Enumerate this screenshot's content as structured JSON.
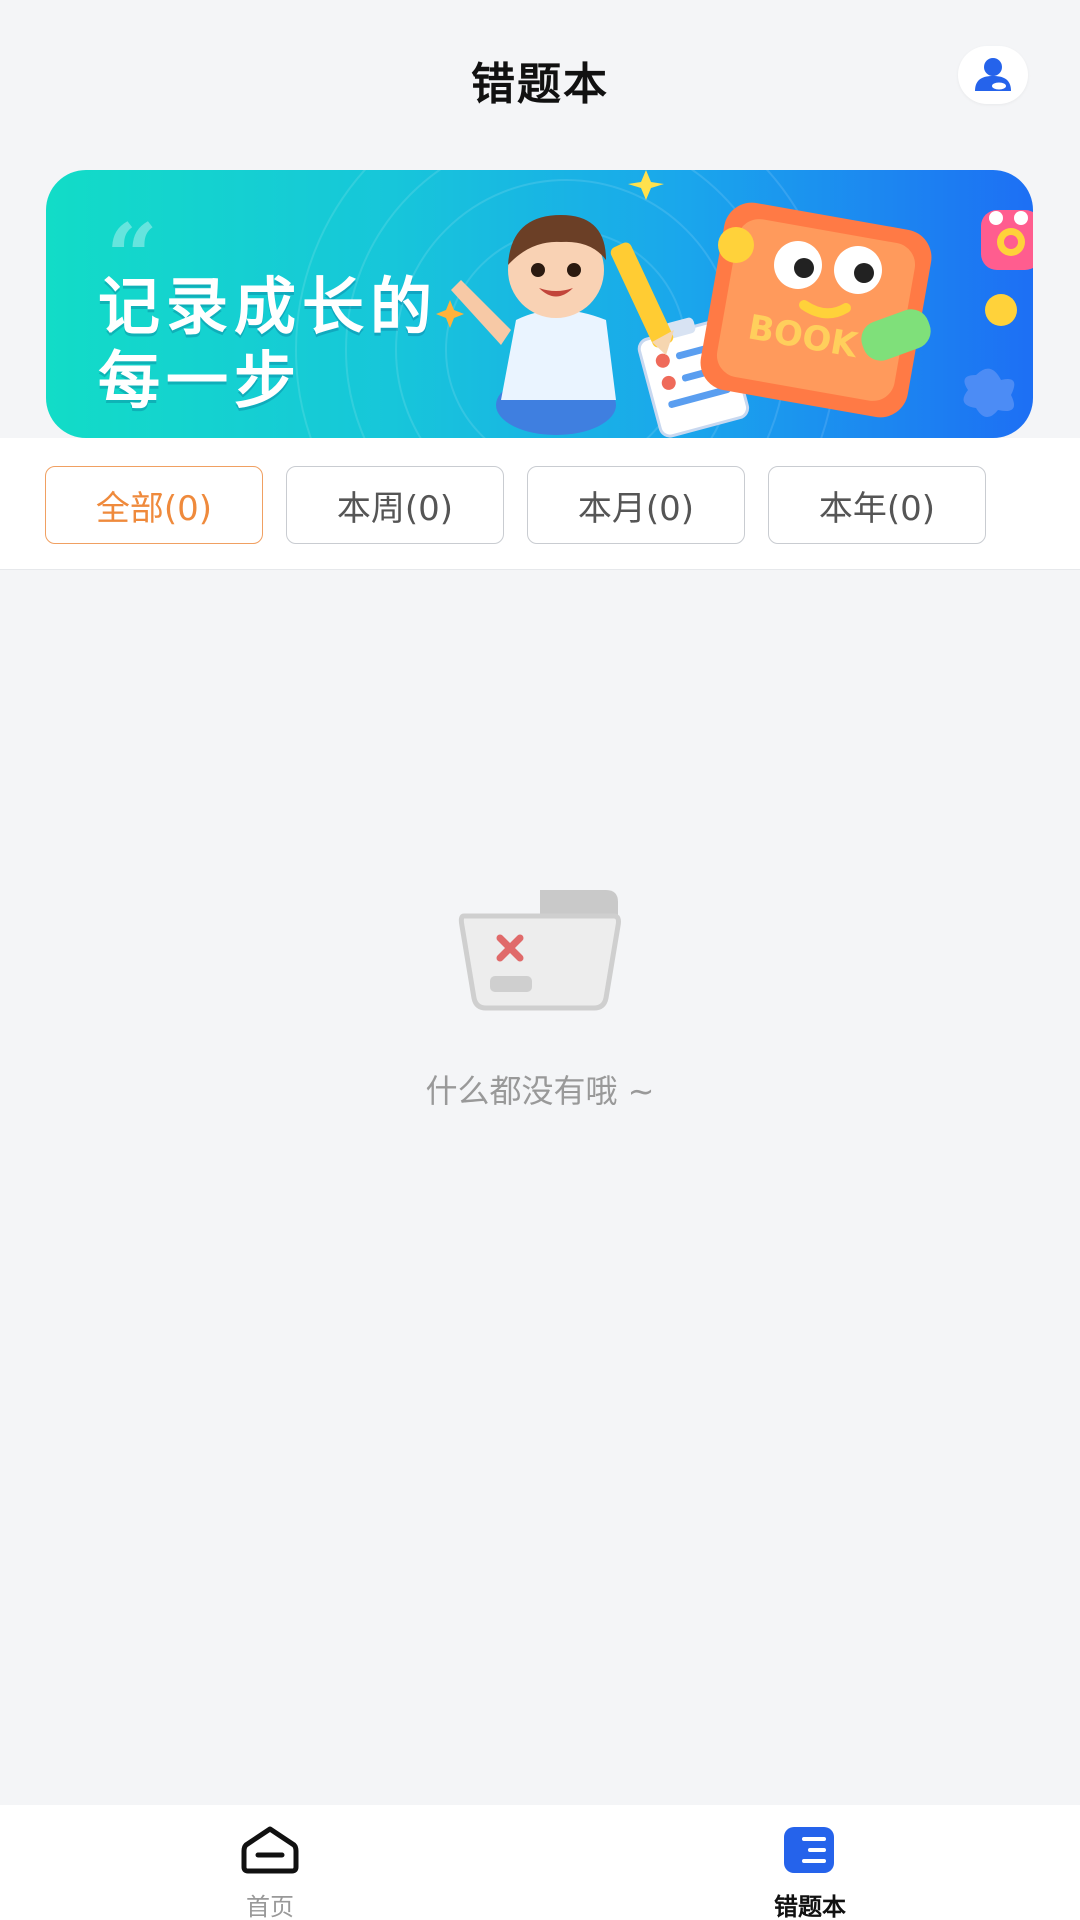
{
  "header": {
    "title": "错题本",
    "profile_icon": "user-icon",
    "accent_color": "#2563eb"
  },
  "banner": {
    "line1": "记录成长的",
    "line2": "每一步",
    "quote_mark": "“",
    "book_label": "BOOK"
  },
  "filters": [
    {
      "label": "全部(0)",
      "active": true
    },
    {
      "label": "本周(0)",
      "active": false
    },
    {
      "label": "本月(0)",
      "active": false
    },
    {
      "label": "本年(0)",
      "active": false
    }
  ],
  "filter_active_color": "#ef8a3c",
  "empty_state": {
    "icon": "empty-folder-icon",
    "text": "什么都没有哦 ~"
  },
  "bottom_nav": [
    {
      "label": "首页",
      "icon": "home-icon",
      "active": false
    },
    {
      "label": "错题本",
      "icon": "notebook-icon",
      "active": true
    }
  ]
}
